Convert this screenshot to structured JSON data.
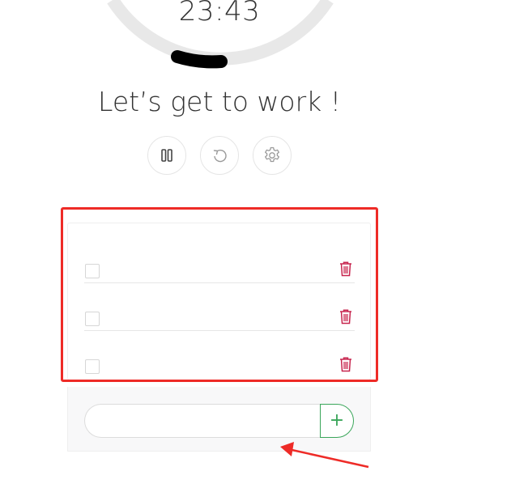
{
  "timer": {
    "time": "23:43",
    "progress_fraction": 0.04
  },
  "motivation": "Let’s get to work !",
  "controls": {
    "pause_icon": "pause-icon",
    "reset_icon": "reset-icon",
    "settings_icon": "gear-icon"
  },
  "tasks": [
    {
      "text": "",
      "completed": false
    },
    {
      "text": "",
      "completed": false
    },
    {
      "text": "",
      "completed": false
    }
  ],
  "add_task": {
    "value": "",
    "placeholder": "",
    "button_label": "+"
  },
  "colors": {
    "delete_icon": "#c7254e",
    "add_button": "#3aa65a",
    "highlight": "#ee2b27",
    "timer_track": "#e8e8e8",
    "timer_progress": "#000000"
  }
}
